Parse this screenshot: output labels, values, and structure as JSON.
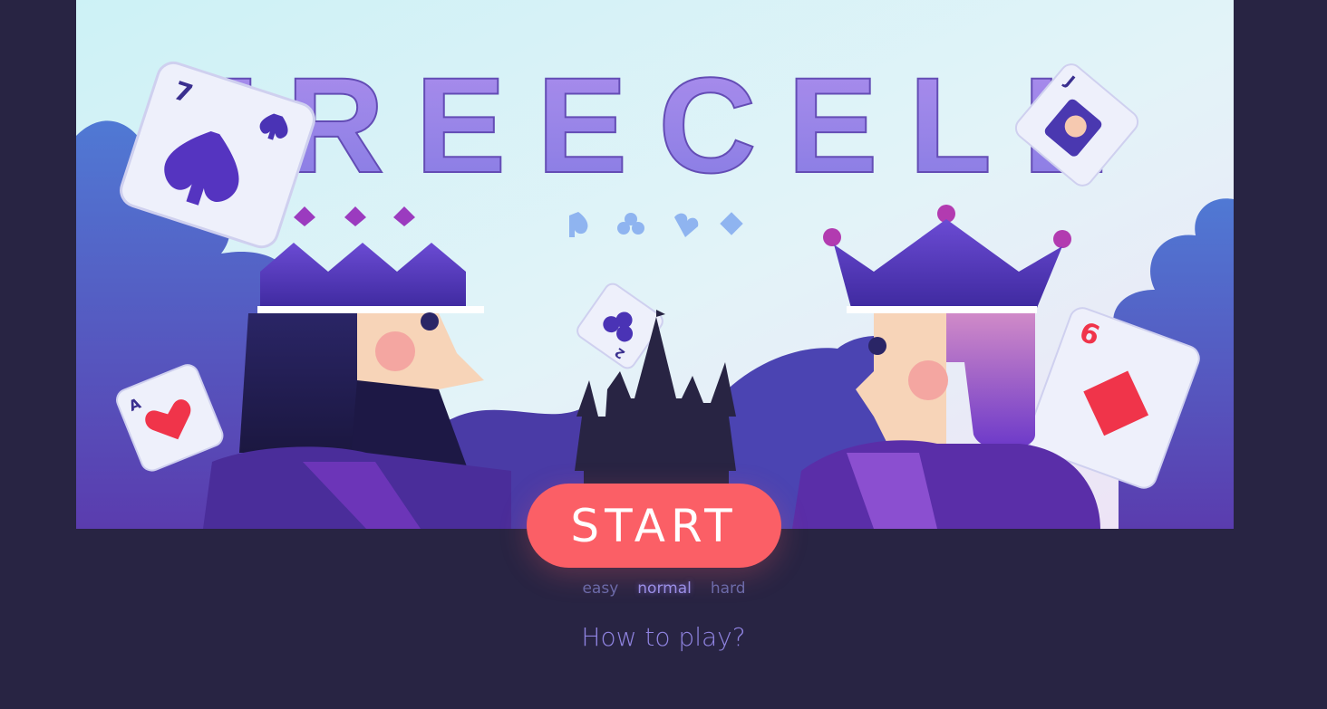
{
  "game": {
    "title": "FREECELL",
    "start_label": "START",
    "difficulty": {
      "options": [
        "easy",
        "normal",
        "hard"
      ],
      "selected": "normal"
    },
    "how_to_play": "How to play?"
  },
  "cards": {
    "seven_spades": "7",
    "jack_spades": "J",
    "two_clubs": "2",
    "ace_hearts": "A",
    "six_diamonds": "6"
  },
  "colors": {
    "background": "#282443",
    "start_button": "#fb5f66",
    "title": "#8f7ae6",
    "accent_purple": "#5b3fbf",
    "red_suit": "#f0344a"
  }
}
